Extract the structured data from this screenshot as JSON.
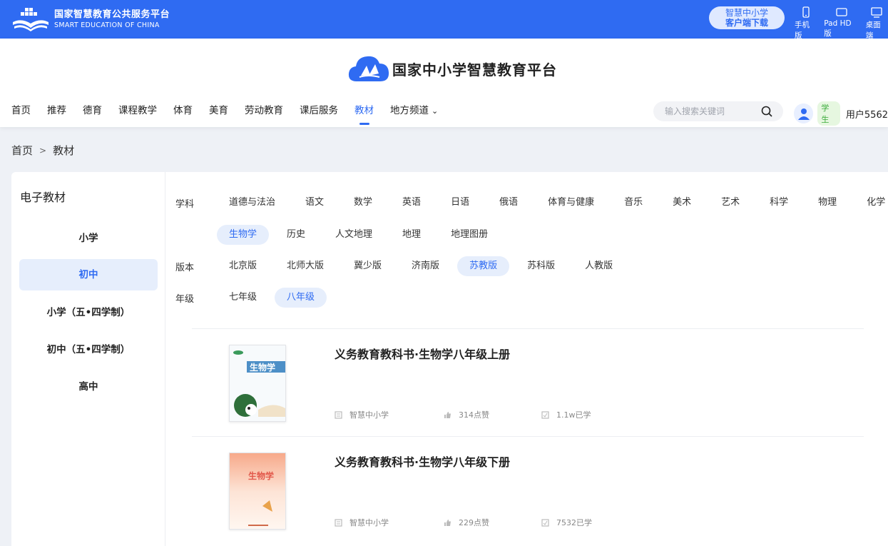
{
  "topbar": {
    "brand_cn": "国家智慧教育公共服务平台",
    "brand_en": "SMART EDUCATION OF CHINA",
    "download_line1": "智慧中小学",
    "download_line2": "客户端下载",
    "devices": [
      {
        "label": "手机版",
        "icon": "phone-icon"
      },
      {
        "label": "Pad HD版",
        "icon": "tablet-icon"
      },
      {
        "label": "桌面端",
        "icon": "desktop-icon"
      }
    ]
  },
  "header": {
    "site_title": "国家中小学智慧教育平台",
    "nav": [
      "首页",
      "推荐",
      "德育",
      "课程教学",
      "体育",
      "美育",
      "劳动教育",
      "课后服务",
      "教材",
      "地方频道"
    ],
    "nav_active": "教材",
    "search_placeholder": "输入搜索关键词",
    "role": "学生",
    "username": "用户5562"
  },
  "breadcrumb": [
    "首页",
    "教材"
  ],
  "sidebar": {
    "title": "电子教材",
    "items": [
      "小学",
      "初中",
      "小学（五•四学制）",
      "初中（五•四学制）",
      "高中"
    ],
    "active": "初中"
  },
  "filters": {
    "subject_label": "学科",
    "subjects_row1": [
      "道德与法治",
      "语文",
      "数学",
      "英语",
      "日语",
      "俄语",
      "体育与健康",
      "音乐",
      "美术",
      "艺术",
      "科学",
      "物理",
      "化学"
    ],
    "subjects_row2": [
      "生物学",
      "历史",
      "人文地理",
      "地理",
      "地理图册"
    ],
    "subject_active": "生物学",
    "edition_label": "版本",
    "editions": [
      "北京版",
      "北师大版",
      "冀少版",
      "济南版",
      "苏教版",
      "苏科版",
      "人教版"
    ],
    "edition_active": "苏教版",
    "grade_label": "年级",
    "grades": [
      "七年级",
      "八年级"
    ],
    "grade_active": "八年级"
  },
  "books": [
    {
      "title": "义务教育教科书·生物学八年级上册",
      "publisher": "智慧中小学",
      "likes": "314点赞",
      "learned": "1.1w已学",
      "cover_title": "生物学"
    },
    {
      "title": "义务教育教科书·生物学八年级下册",
      "publisher": "智慧中小学",
      "likes": "229点赞",
      "learned": "7532已学",
      "cover_title": "生物学"
    }
  ],
  "colors": {
    "primary": "#2f6bf2",
    "active_bg": "#e6eefc"
  }
}
